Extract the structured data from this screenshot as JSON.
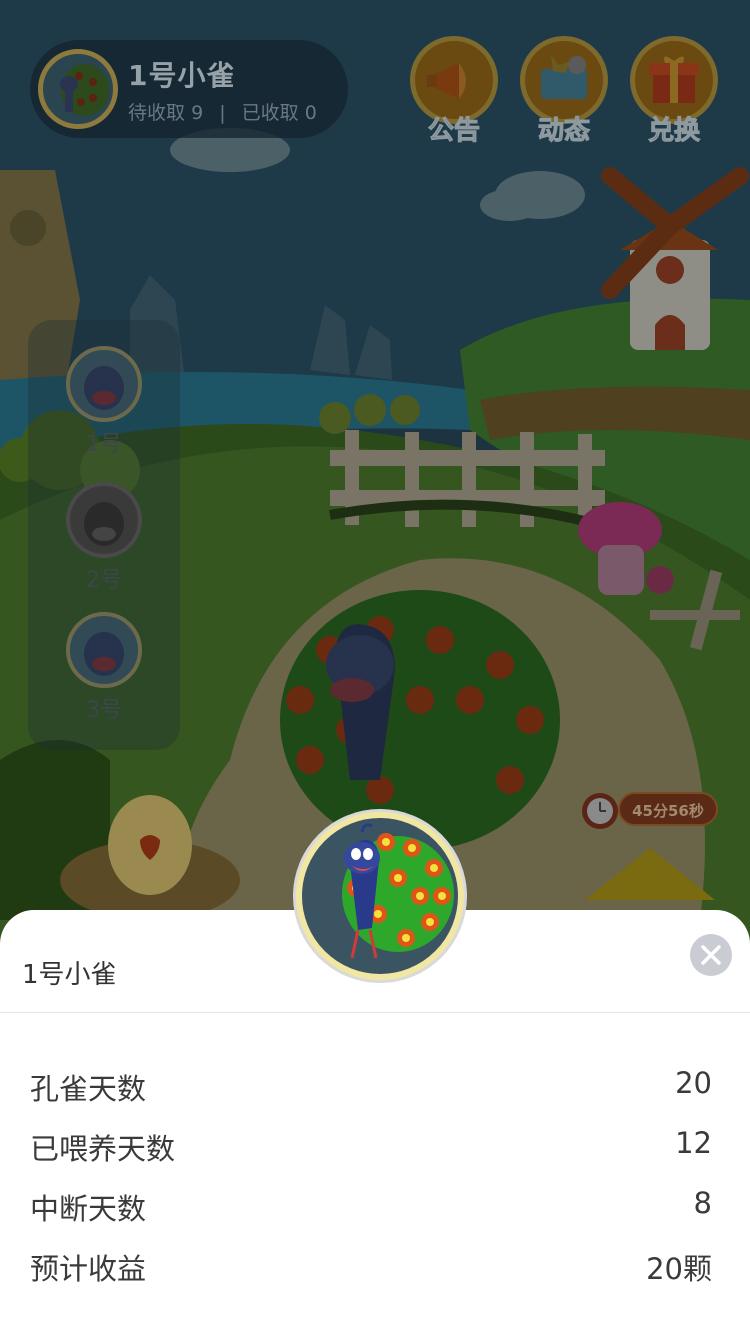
{
  "profile": {
    "name": "1号小雀",
    "pending_label": "待收取",
    "pending_count": "9",
    "separator": "|",
    "collected_label": "已收取",
    "collected_count": "0"
  },
  "top_buttons": [
    {
      "label": "公告",
      "icon": "megaphone-icon"
    },
    {
      "label": "动态",
      "icon": "news-icon"
    },
    {
      "label": "兑换",
      "icon": "gift-icon"
    }
  ],
  "side_list": [
    {
      "label": "1号"
    },
    {
      "label": "2号"
    },
    {
      "label": "3号"
    }
  ],
  "timer": {
    "text": "45分56秒",
    "icon": "alarm-clock-icon"
  },
  "sheet": {
    "title": "1号小雀",
    "close_icon": "close-icon",
    "rows": [
      {
        "label": "孔雀天数",
        "value": "20"
      },
      {
        "label": "已喂养天数",
        "value": "12"
      },
      {
        "label": "中断天数",
        "value": "8"
      },
      {
        "label": "预计收益",
        "value": "20颗"
      }
    ]
  },
  "colors": {
    "sheet_bg": "#ffffff",
    "avatar_ring": "#f1e7a2",
    "close_button": "#c9ccd2"
  }
}
